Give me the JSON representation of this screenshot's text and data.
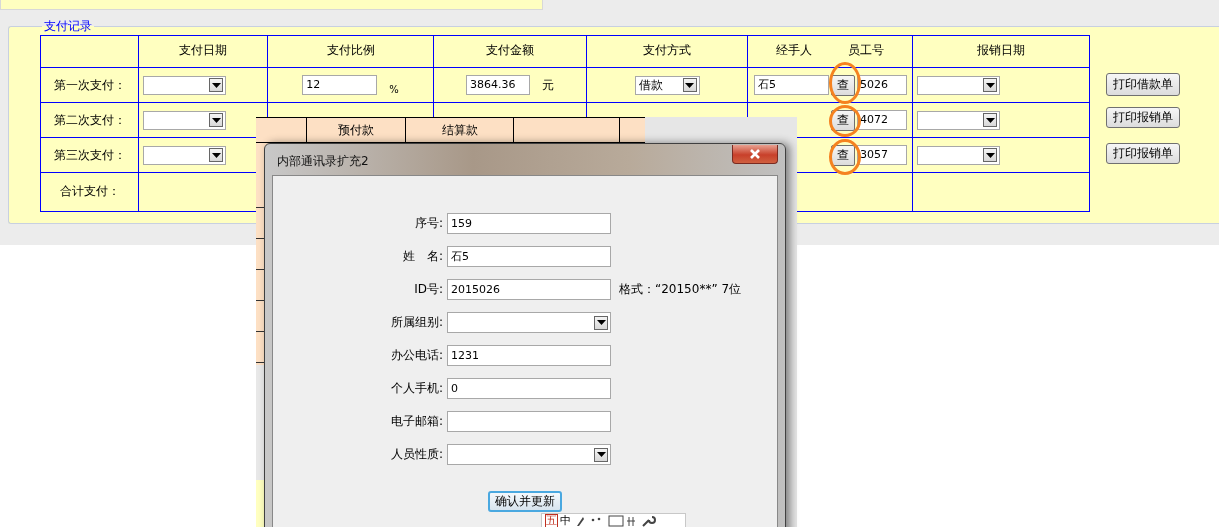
{
  "section": {
    "legend": "支付记录",
    "columns": [
      "支付日期",
      "支付比例",
      "支付金额",
      "支付方式",
      "经手人",
      "员工号",
      "报销日期"
    ],
    "rows": [
      {
        "label": "第一次支付：",
        "ratio": "12",
        "ratio_unit": "%",
        "amount": "3864.36",
        "amount_unit": "元",
        "method": "借款",
        "handler": "石5",
        "lookup": "查",
        "employee_id": "5026",
        "circled": true,
        "print_button": "打印借款单"
      },
      {
        "label": "第二次支付：",
        "lookup": "查",
        "employee_id": "4072",
        "circled": true,
        "print_button": "打印报销单"
      },
      {
        "label": "第三次支付：",
        "lookup": "查",
        "employee_id": "3057",
        "circled": true,
        "print_button": "打印报销单"
      }
    ],
    "total_label": "合计支付："
  },
  "back_panel": {
    "columns": [
      "预付款",
      "结算款"
    ]
  },
  "dialog": {
    "title": "内部通讯录扩充2",
    "fields": [
      {
        "label": "序号:",
        "kind": "text",
        "value": "159"
      },
      {
        "label": "姓　名:",
        "kind": "text",
        "value": "石5"
      },
      {
        "label": "ID号:",
        "kind": "text",
        "value": "2015026",
        "hint": "格式：“20150**” 7位"
      },
      {
        "label": "所属组别:",
        "kind": "select"
      },
      {
        "label": "办公电话:",
        "kind": "text",
        "value": "1231"
      },
      {
        "label": "个人手机:",
        "kind": "text",
        "value": "0"
      },
      {
        "label": "电子邮箱:",
        "kind": "text"
      },
      {
        "label": "人员性质:",
        "kind": "select"
      }
    ],
    "submit": "确认并更新"
  },
  "ime_bar": {
    "items": [
      "五",
      "中"
    ]
  }
}
